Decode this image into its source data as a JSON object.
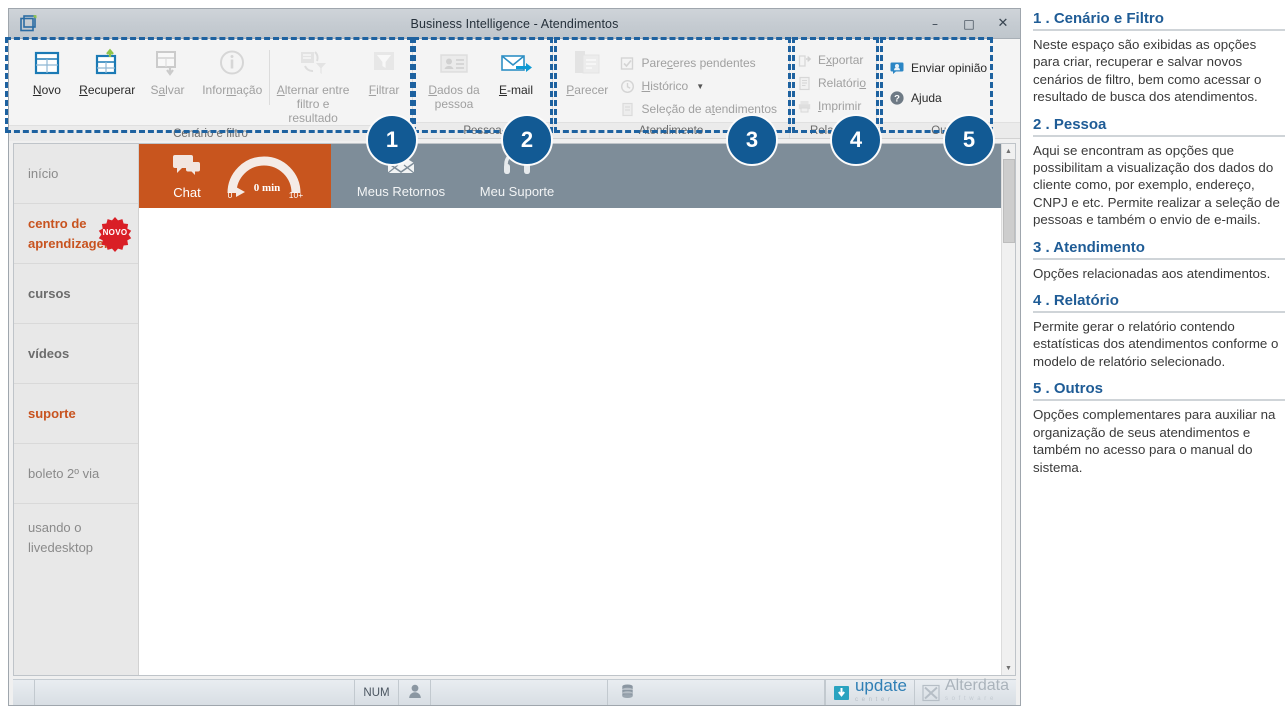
{
  "window": {
    "title": "Business Intelligence - Atendimentos",
    "app_icon": "window-app-icon",
    "minimize": "–",
    "maximize": "□",
    "close": "✕"
  },
  "ribbon": {
    "groups": [
      {
        "id": "cenario",
        "title": "Cenário e filtro",
        "badge": "1",
        "buttons": [
          {
            "label": "Novo",
            "accel": "N",
            "icon": "new-table-icon",
            "disabled": false
          },
          {
            "label": "Recuperar",
            "accel": "R",
            "icon": "restore-table-icon",
            "disabled": false
          },
          {
            "label": "Salvar",
            "accel": "S",
            "icon": "save-table-icon",
            "disabled": true
          },
          {
            "label": "Informação",
            "accel": "ç",
            "icon": "info-icon",
            "disabled": true
          },
          {
            "label": "Alternar entre filtro e resultado",
            "accel": "A",
            "icon": "swap-filter-icon",
            "disabled": true
          },
          {
            "label": "Filtrar",
            "accel": "F",
            "icon": "funnel-icon",
            "disabled": true
          }
        ]
      },
      {
        "id": "pessoa",
        "title": "Pessoa",
        "badge": "2",
        "buttons": [
          {
            "label": "Dados da pessoa",
            "accel": "D",
            "icon": "contact-card-icon",
            "disabled": true
          },
          {
            "label": "E-mail",
            "accel": "E",
            "icon": "envelope-send-icon",
            "disabled": false
          }
        ]
      },
      {
        "id": "atendimento",
        "title": "Atendimento",
        "badge": "3",
        "buttons": [
          {
            "label": "Parecer",
            "accel": "P",
            "icon": "document-stack-icon",
            "disabled": true
          }
        ],
        "small_items": [
          {
            "label": "Pareceres pendentes",
            "accel": "c",
            "icon": "checklist-icon",
            "disabled": true,
            "caret": false
          },
          {
            "label": "Histórico",
            "accel": "H",
            "icon": "clock-history-icon",
            "disabled": true,
            "caret": true
          },
          {
            "label": "Seleção de atendimentos",
            "accel": "t",
            "icon": "select-list-icon",
            "disabled": true,
            "caret": false
          }
        ]
      },
      {
        "id": "relatorio",
        "title": "Relatório",
        "badge": "4",
        "small_items": [
          {
            "label": "Exportar",
            "accel": "x",
            "icon": "export-icon",
            "disabled": true,
            "caret": false
          },
          {
            "label": "Relatório",
            "accel": "o",
            "icon": "report-icon",
            "disabled": true,
            "caret": false
          },
          {
            "label": "Imprimir",
            "accel": "I",
            "icon": "printer-icon",
            "disabled": true,
            "caret": false
          }
        ]
      },
      {
        "id": "outros",
        "title": "Outros",
        "badge": "5",
        "small_items": [
          {
            "label": "Enviar opinião",
            "accel": "",
            "icon": "feedback-person-icon",
            "disabled": false,
            "caret": false
          },
          {
            "label": "Ajuda",
            "accel": "j",
            "icon": "help-question-icon",
            "disabled": false,
            "caret": false
          }
        ]
      }
    ]
  },
  "sidebar": {
    "items": [
      {
        "label": "início",
        "style": "muted",
        "badge": null
      },
      {
        "label": "centro de aprendizagem",
        "style": "orange",
        "badge": "NOVO"
      },
      {
        "label": "cursos",
        "style": "bold",
        "badge": null
      },
      {
        "label": "vídeos",
        "style": "bold",
        "badge": null
      },
      {
        "label": "suporte",
        "style": "orange",
        "badge": null
      },
      {
        "label": "boleto 2º via",
        "style": "muted",
        "badge": null
      },
      {
        "label": "usando o livedesktop",
        "style": "muted",
        "badge": null
      }
    ]
  },
  "top_strip": {
    "chat": {
      "label": "Chat",
      "icon": "chat-bubbles-icon"
    },
    "gauge": {
      "value": "0 min",
      "min": "0",
      "max": "10+",
      "icon": "wait-time-gauge"
    },
    "tools": [
      {
        "label": "Meus Retornos",
        "icon": "envelope-open-icon"
      },
      {
        "label": "Meu Suporte",
        "icon": "headset-icon"
      }
    ]
  },
  "status_bar": {
    "num_indicator": "NUM",
    "user_icon": "user-icon",
    "db_icon": "database-icon",
    "logos": [
      {
        "name": "update-center-logo",
        "primary": "update",
        "secondary": "c e n t e r"
      },
      {
        "name": "alterdata-software-logo",
        "primary": "Alterdata",
        "secondary": "s o f t w a r e"
      }
    ]
  },
  "doc_panel": {
    "sections": [
      {
        "heading": "1 . Cenário e Filtro",
        "body": "Neste espaço são exibidas as opções para criar, recuperar e salvar novos cenários de filtro, bem como acessar o resultado de busca dos atendimentos."
      },
      {
        "heading": "2 . Pessoa",
        "body": "Aqui se encontram as opções que possibilitam a visualização dos dados do cliente como, por exemplo, endereço, CNPJ e etc. Permite realizar a seleção de pessoas e também o envio de e-mails."
      },
      {
        "heading": "3 . Atendimento",
        "body": "Opções relacionadas aos atendimentos."
      },
      {
        "heading": "4 . Relatório",
        "body": "Permite gerar o relatório contendo estatísticas dos atendimentos conforme o modelo de relatório selecionado."
      },
      {
        "heading": "5 . Outros",
        "body": "Opções complementares para auxiliar na organização de seus atendimentos e também no acesso para o manual do sistema."
      }
    ]
  },
  "colors": {
    "accent_blue": "#1f5c96",
    "badge_blue": "#125a94",
    "highlight_dash": "#1e62a0",
    "chat_orange": "#c8551e",
    "tools_gray": "#7e8d99",
    "sidebar_orange": "#c8531f",
    "novo_red": "#d91f26"
  }
}
